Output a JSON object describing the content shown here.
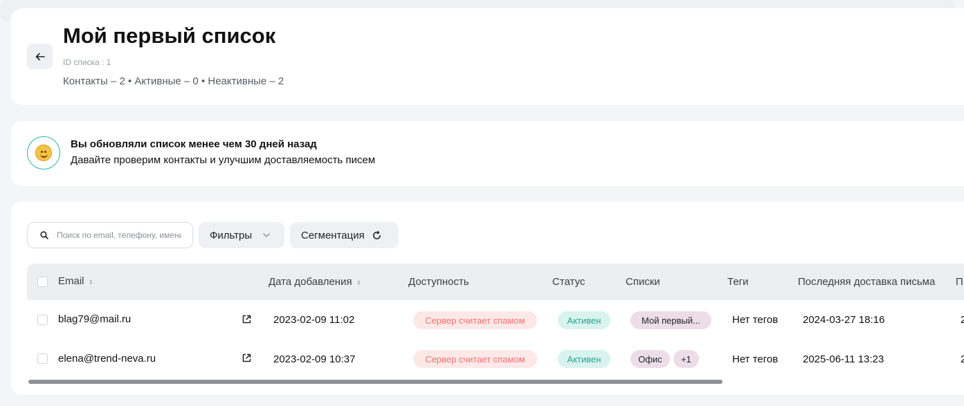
{
  "header": {
    "back_icon": "arrow-left-icon",
    "title": "Мой первый список",
    "list_id": "ID списка : 1",
    "stats": "Контакты – 2 • Активные – 0 • Неактивные – 2"
  },
  "notice": {
    "icon": "smile-icon",
    "title": "Вы обновляли список менее чем 30 дней назад",
    "text": "Давайте проверим контакты и улучшим доставляемость писем"
  },
  "toolbar": {
    "search_placeholder": "Поиск по email, телефону, имени",
    "filters_label": "Фильтры",
    "segmentation_label": "Сегментация"
  },
  "table": {
    "columns": {
      "email": "Email",
      "date_added": "Дата добавления",
      "availability": "Доступность",
      "status": "Статус",
      "lists": "Списки",
      "tags": "Теги",
      "last_delivery": "Последняя доставка письма",
      "next": "П"
    },
    "rows": [
      {
        "email": "blag79@mail.ru",
        "date_added": "2023-02-09 11:02",
        "availability": "Сервер считает спамом",
        "status": "Активен",
        "list": "Мой первый...",
        "extra_lists": "",
        "tags": "Нет тегов",
        "last_delivery": "2024-03-27 18:16",
        "next": "2"
      },
      {
        "email": "elena@trend-neva.ru",
        "date_added": "2023-02-09 10:37",
        "availability": "Сервер считает спамом",
        "status": "Активен",
        "list": "Офис",
        "extra_lists": "+1",
        "tags": "Нет тегов",
        "last_delivery": "2025-06-11 13:23",
        "next": "2"
      }
    ]
  },
  "colors": {
    "spam_bg": "#fde8e8",
    "spam_text": "#f07070",
    "active_bg": "#d9f3ee",
    "active_text": "#2aa38f",
    "list_bg": "#ecdde9",
    "accent_ring": "#2ab3a5"
  }
}
